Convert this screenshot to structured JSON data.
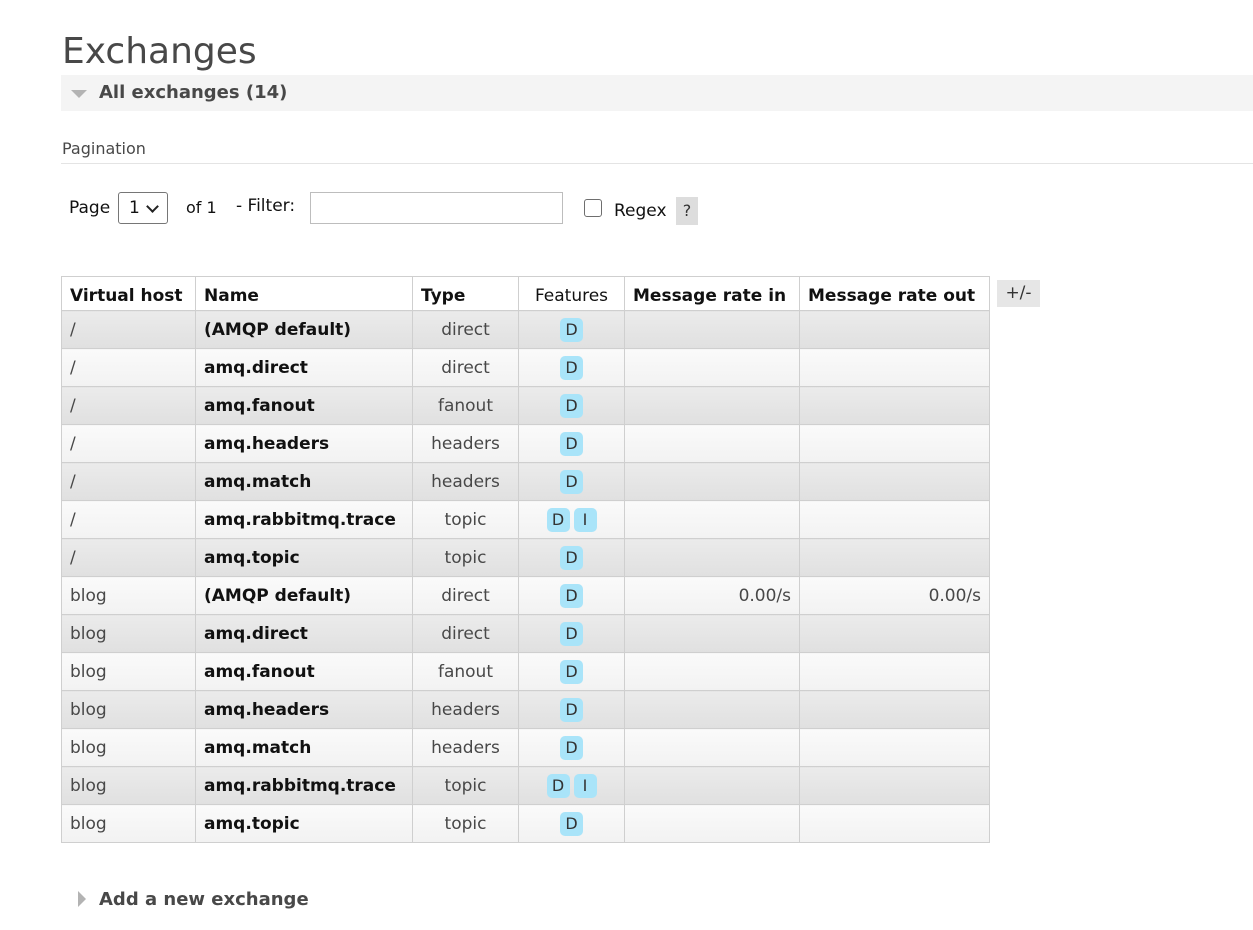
{
  "page": {
    "title": "Exchanges"
  },
  "section": {
    "title": "All exchanges (14)"
  },
  "pagination": {
    "heading": "Pagination",
    "page_label": "Page",
    "page_value": "1",
    "of_label": "of 1",
    "filter_label": "- Filter:",
    "filter_value": "",
    "regex_label": "Regex",
    "regex_checked": false,
    "help_label": "?"
  },
  "table": {
    "headers": {
      "vhost": "Virtual host",
      "name": "Name",
      "type": "Type",
      "features": "Features",
      "rate_in": "Message rate in",
      "rate_out": "Message rate out"
    },
    "toggle_columns_label": "+/-",
    "rows": [
      {
        "vhost": "/",
        "name": "(AMQP default)",
        "type": "direct",
        "features": [
          "D"
        ],
        "rate_in": "",
        "rate_out": ""
      },
      {
        "vhost": "/",
        "name": "amq.direct",
        "type": "direct",
        "features": [
          "D"
        ],
        "rate_in": "",
        "rate_out": ""
      },
      {
        "vhost": "/",
        "name": "amq.fanout",
        "type": "fanout",
        "features": [
          "D"
        ],
        "rate_in": "",
        "rate_out": ""
      },
      {
        "vhost": "/",
        "name": "amq.headers",
        "type": "headers",
        "features": [
          "D"
        ],
        "rate_in": "",
        "rate_out": ""
      },
      {
        "vhost": "/",
        "name": "amq.match",
        "type": "headers",
        "features": [
          "D"
        ],
        "rate_in": "",
        "rate_out": ""
      },
      {
        "vhost": "/",
        "name": "amq.rabbitmq.trace",
        "type": "topic",
        "features": [
          "D",
          "I"
        ],
        "rate_in": "",
        "rate_out": ""
      },
      {
        "vhost": "/",
        "name": "amq.topic",
        "type": "topic",
        "features": [
          "D"
        ],
        "rate_in": "",
        "rate_out": ""
      },
      {
        "vhost": "blog",
        "name": "(AMQP default)",
        "type": "direct",
        "features": [
          "D"
        ],
        "rate_in": "0.00/s",
        "rate_out": "0.00/s"
      },
      {
        "vhost": "blog",
        "name": "amq.direct",
        "type": "direct",
        "features": [
          "D"
        ],
        "rate_in": "",
        "rate_out": ""
      },
      {
        "vhost": "blog",
        "name": "amq.fanout",
        "type": "fanout",
        "features": [
          "D"
        ],
        "rate_in": "",
        "rate_out": ""
      },
      {
        "vhost": "blog",
        "name": "amq.headers",
        "type": "headers",
        "features": [
          "D"
        ],
        "rate_in": "",
        "rate_out": ""
      },
      {
        "vhost": "blog",
        "name": "amq.match",
        "type": "headers",
        "features": [
          "D"
        ],
        "rate_in": "",
        "rate_out": ""
      },
      {
        "vhost": "blog",
        "name": "amq.rabbitmq.trace",
        "type": "topic",
        "features": [
          "D",
          "I"
        ],
        "rate_in": "",
        "rate_out": ""
      },
      {
        "vhost": "blog",
        "name": "amq.topic",
        "type": "topic",
        "features": [
          "D"
        ],
        "rate_in": "",
        "rate_out": ""
      }
    ]
  },
  "add_section": {
    "title": "Add a new exchange"
  },
  "colors": {
    "badge": "#a9e4f9",
    "text": "#484848",
    "section_bg": "#f4f4f4"
  }
}
